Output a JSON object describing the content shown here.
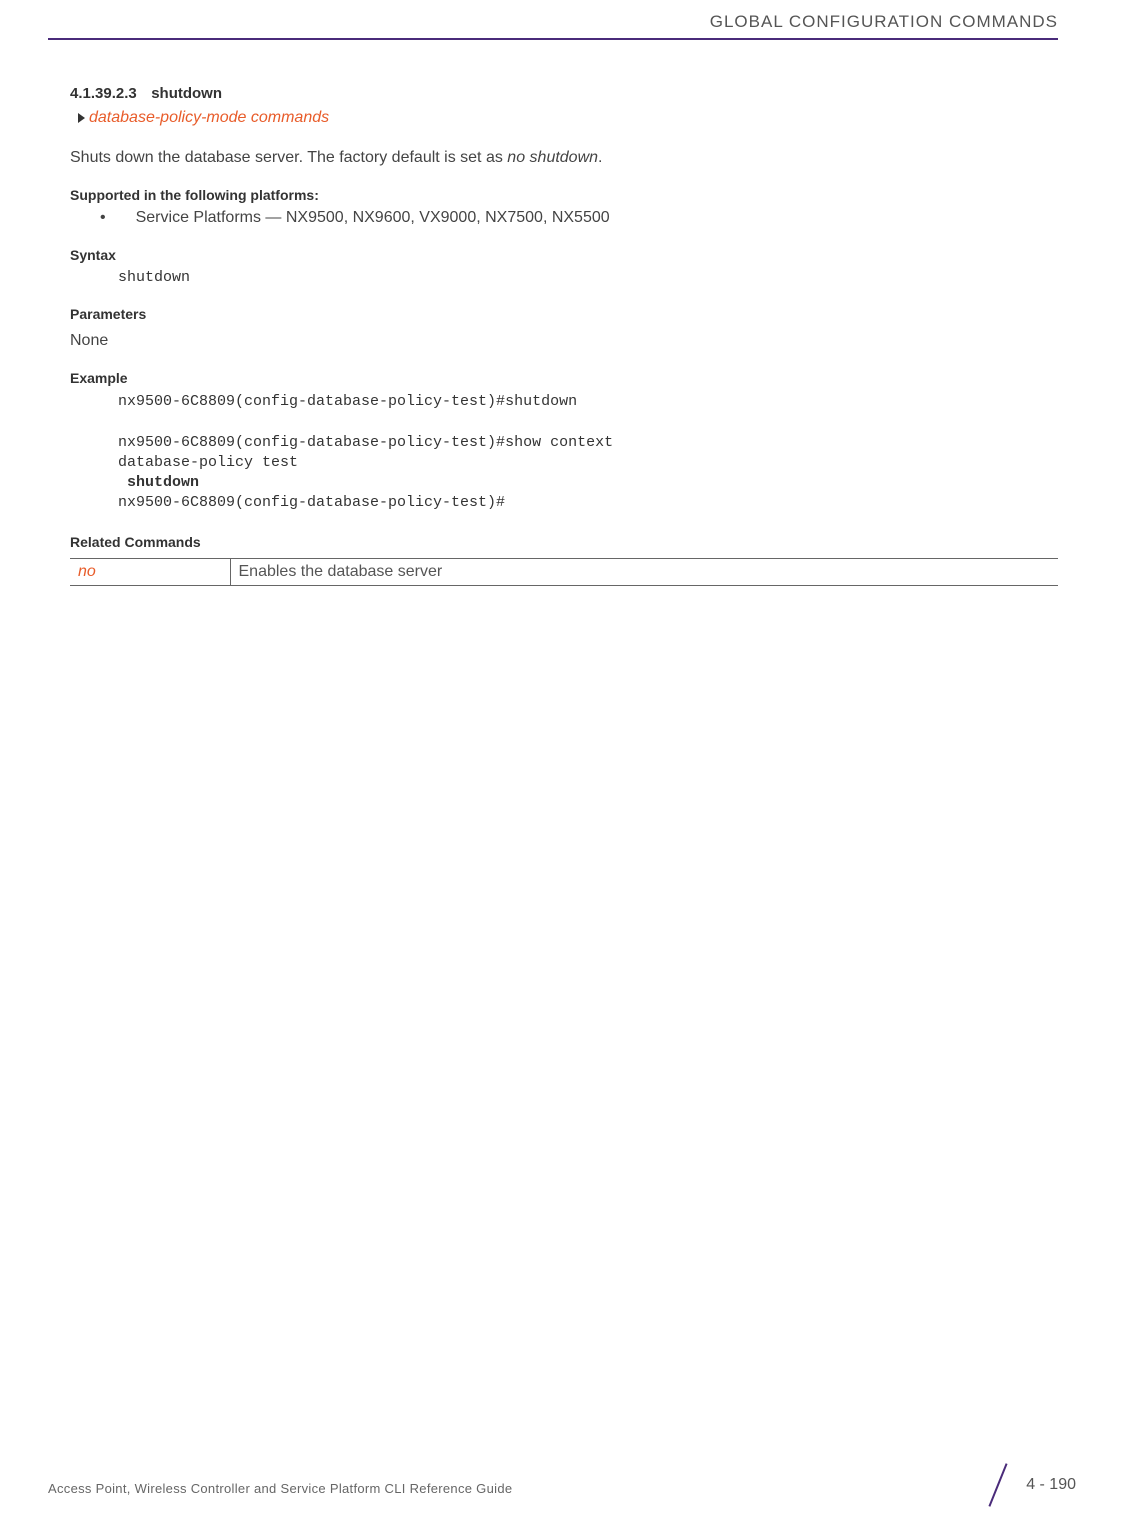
{
  "header": {
    "title": "GLOBAL CONFIGURATION COMMANDS"
  },
  "section": {
    "number": "4.1.39.2.3",
    "title": "shutdown",
    "breadcrumb": "database-policy-mode commands",
    "description_pre": "Shuts down the database server. The factory default is set as ",
    "description_italic": "no shutdown",
    "description_post": "."
  },
  "supported": {
    "heading": "Supported in the following platforms:",
    "line": "Service Platforms — NX9500, NX9600, VX9000, NX7500, NX5500"
  },
  "syntax": {
    "heading": "Syntax",
    "code": "shutdown"
  },
  "parameters": {
    "heading": "Parameters",
    "value": "None"
  },
  "example": {
    "heading": "Example",
    "line1": "nx9500-6C8809(config-database-policy-test)#shutdown",
    "line2": "nx9500-6C8809(config-database-policy-test)#show context",
    "line3": "database-policy test",
    "line4": " shutdown",
    "line5": "nx9500-6C8809(config-database-policy-test)#"
  },
  "related": {
    "heading": "Related Commands",
    "command": "no",
    "desc": "Enables the database server"
  },
  "footer": {
    "text": "Access Point, Wireless Controller and Service Platform CLI Reference Guide",
    "page": "4 - 190"
  }
}
